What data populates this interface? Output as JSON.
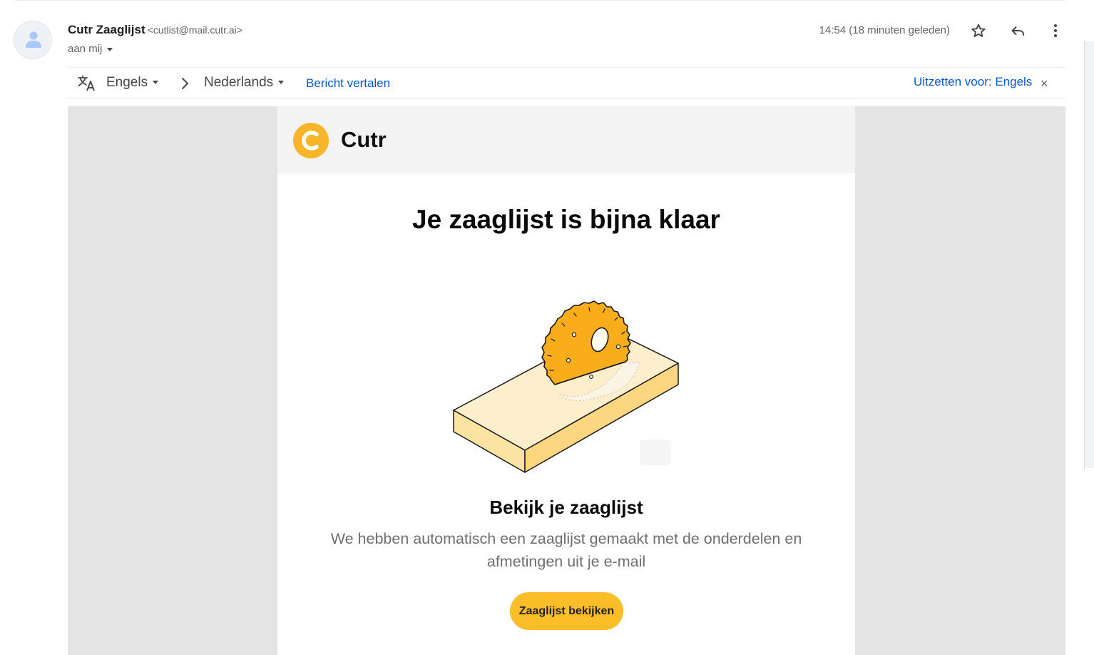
{
  "email": {
    "sender_name": "Cutr Zaaglijst",
    "sender_email": "<cutlist@mail.cutr.ai>",
    "recipient": "aan mij",
    "timestamp": "14:54 (18 minuten geleden)"
  },
  "icons": {
    "avatar": "person-icon",
    "star": "star-icon",
    "reply": "reply-icon",
    "more": "more-vert-icon",
    "translate": "translate-icon",
    "arrow": "chevron-right-icon",
    "close": "close-icon"
  },
  "translate_bar": {
    "source_lang": "Engels",
    "target_lang": "Nederlands",
    "translate_link": "Bericht vertalen",
    "turn_off": "Uitzetten voor: Engels",
    "close": "×"
  },
  "message": {
    "brand": "Cutr",
    "title": "Je zaaglijst is bijna klaar",
    "subtitle": "Bekijk je zaaglijst",
    "body": "We hebben automatisch een zaaglijst gemaakt met de onderdelen en afmetingen uit je e-mail",
    "cta": "Zaaglijst bekijken"
  },
  "colors": {
    "brand_yellow": "#fbbd28",
    "saw_orange": "#f9ad1b",
    "wood_light": "#fdeecc",
    "link_blue": "#0b57d0"
  }
}
